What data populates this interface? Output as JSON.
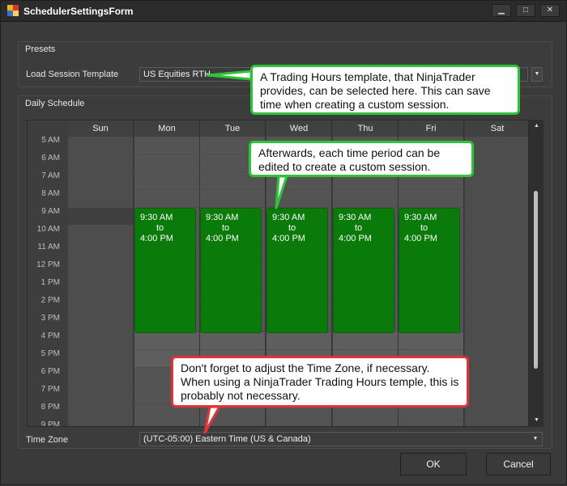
{
  "window": {
    "title": "SchedulerSettingsForm",
    "controls": {
      "minimize": "▁",
      "maximize": "□",
      "close": "✕"
    }
  },
  "presets": {
    "group_title": "Presets",
    "load_label": "Load Session Template",
    "template_value": "US Equities RTH",
    "dropdown_icon": "chevron-down-icon"
  },
  "daily_schedule": {
    "group_title": "Daily Schedule",
    "days": [
      "Sun",
      "Mon",
      "Tue",
      "Wed",
      "Thu",
      "Fri",
      "Sat"
    ],
    "times": [
      "5 AM",
      "6 AM",
      "7 AM",
      "8 AM",
      "9 AM",
      "10 AM",
      "11 AM",
      "12 PM",
      "1 PM",
      "2 PM",
      "3 PM",
      "4 PM",
      "5 PM",
      "6 PM",
      "7 PM",
      "8 PM",
      "9 PM"
    ],
    "sessions": [
      {
        "day": "Mon",
        "start": "9:30 AM",
        "to": "to",
        "end": "4:00 PM"
      },
      {
        "day": "Tue",
        "start": "9:30 AM",
        "to": "to",
        "end": "4:00 PM"
      },
      {
        "day": "Wed",
        "start": "9:30 AM",
        "to": "to",
        "end": "4:00 PM"
      },
      {
        "day": "Thu",
        "start": "9:30 AM",
        "to": "to",
        "end": "4:00 PM"
      },
      {
        "day": "Fri",
        "start": "9:30 AM",
        "to": "to",
        "end": "4:00 PM"
      }
    ],
    "session_color": "#0a7b0a"
  },
  "timezone": {
    "label": "Time Zone",
    "value": "(UTC-05:00) Eastern Time (US & Canada)"
  },
  "buttons": {
    "ok": "OK",
    "cancel": "Cancel"
  },
  "callouts": {
    "template": "A Trading Hours template, that NinjaTrader provides, can be selected here.  This can save time when creating a custom session.",
    "edit": "Afterwards, each time period can be edited to create a custom session.",
    "timezone": "Don't forget to adjust the Time Zone, if necessary. When using a NinjaTrader Trading Hours temple, this is probably not necessary."
  },
  "colors": {
    "callout_green": "#2ec43a",
    "callout_red": "#e0343a",
    "session_green": "#0a7b0a"
  }
}
